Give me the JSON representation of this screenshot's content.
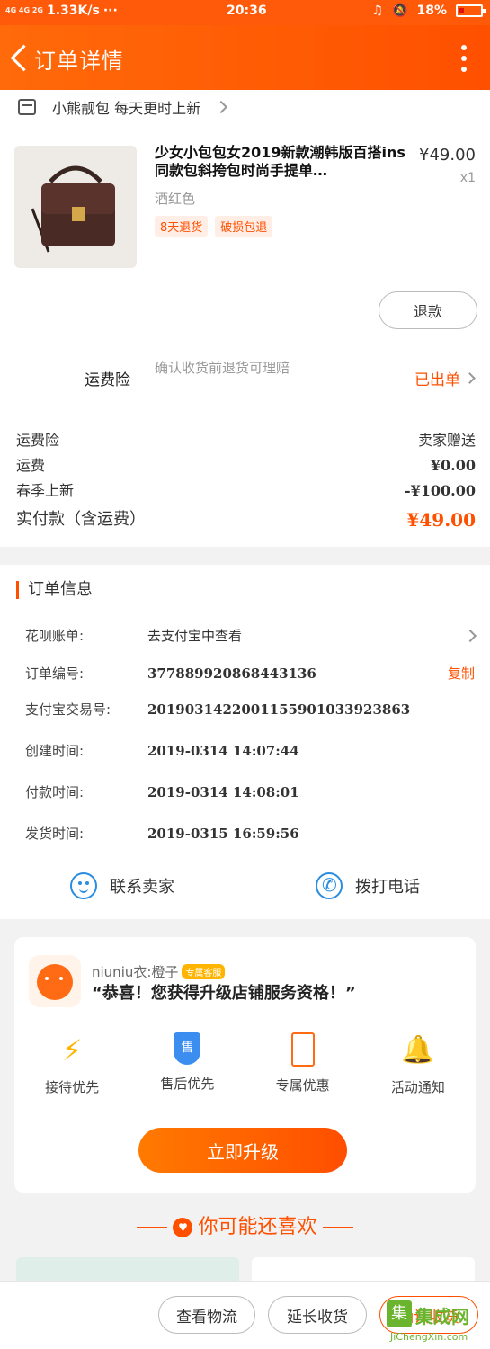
{
  "status_bar": {
    "network": "4G 4G 2G",
    "speed": "1.33K/s",
    "dots": "···",
    "time": "20:36",
    "battery": "18%"
  },
  "header": {
    "title": "订单详情"
  },
  "shop": {
    "name": "小熊靓包 每天更时上新"
  },
  "product": {
    "title": "少女小包包女2019新款潮韩版百搭ins同款包斜挎包时尚手提单…",
    "price": "¥49.00",
    "qty": "x1",
    "sku": "酒红色",
    "tags": [
      "8天退货",
      "破损包退"
    ],
    "refund_label": "退款"
  },
  "insurance": {
    "label": "运费险",
    "desc": "确认收货前退货可理赔",
    "status": "已出单"
  },
  "fees": [
    {
      "label": "运费险",
      "value": "卖家赠送"
    },
    {
      "label": "运费",
      "value": "¥0.00"
    },
    {
      "label": "春季上新",
      "value": "-¥100.00"
    }
  ],
  "total": {
    "label": "实付款（含运费）",
    "value": "¥49.00"
  },
  "order_info": {
    "title": "订单信息",
    "huabei": {
      "label": "花呗账单:",
      "value": "去支付宝中查看"
    },
    "order_no": {
      "label": "订单编号:",
      "value": "377889920868443136",
      "action": "复制"
    },
    "alipay_no": {
      "label": "支付宝交易号:",
      "value": "2019031422001155901033923863"
    },
    "created": {
      "label": "创建时间:",
      "value": "2019-0314 14:07:44"
    },
    "paid": {
      "label": "付款时间:",
      "value": "2019-0314 14:08:01"
    },
    "shipped": {
      "label": "发货时间:",
      "value": "2019-0315 16:59:56"
    }
  },
  "contact": {
    "seller": "联系卖家",
    "call": "拨打电话"
  },
  "member": {
    "name": "niuniu衣:橙子",
    "badge": "专属客服",
    "message": "“恭喜！您获得升级店铺服务资格！”",
    "perks": [
      "接待优先",
      "售后优先",
      "专属优惠",
      "活动通知"
    ],
    "shield_text": "售",
    "upgrade_label": "立即升级"
  },
  "recommend": {
    "title": "你可能还喜欢"
  },
  "bottom": {
    "logistics": "查看物流",
    "extend": "延长收货",
    "confirm": "确认收货"
  },
  "watermark": {
    "name": "集成网",
    "url": "JiChengXin.com"
  },
  "colors": {
    "accent": "#ff5000",
    "link_blue": "#2a8de0",
    "gold": "#ffb400"
  }
}
